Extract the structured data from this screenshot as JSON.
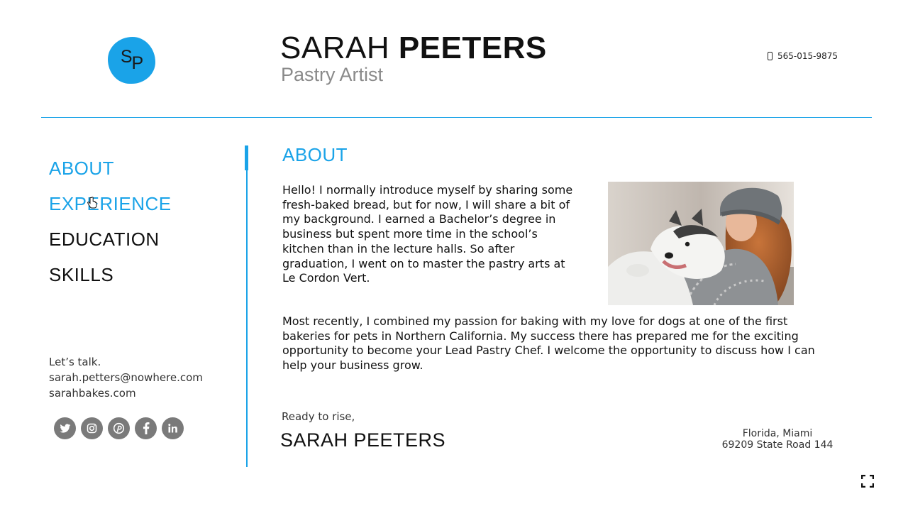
{
  "logo": {
    "initial_first": "S",
    "initial_last": "P",
    "color": "#1aa3e8"
  },
  "header": {
    "first_name": "SARAH",
    "last_name": "PEETERS",
    "role": "Pastry Artist",
    "phone": "565-015-9875"
  },
  "nav": {
    "items": [
      {
        "label": "ABOUT",
        "active": true
      },
      {
        "label": "EXPERIENCE",
        "active": true
      },
      {
        "label": "EDUCATION",
        "active": false
      },
      {
        "label": "SKILLS",
        "active": false
      }
    ]
  },
  "contact": {
    "prompt": "Let’s talk.",
    "email": "sarah.petters@nowhere.com",
    "website": "sarahbakes.com"
  },
  "social": {
    "icons": [
      "twitter-icon",
      "instagram-icon",
      "pinterest-icon",
      "facebook-icon",
      "linkedin-icon"
    ]
  },
  "about": {
    "title": "ABOUT",
    "paragraph1": "Hello! I normally introduce myself by sharing some fresh-baked bread, but for now, I will share a bit of my background. I earned a Bachelor’s degree in business but spent more time in the school’s kitchen than in the lecture halls. So after graduation, I went on to master the pastry arts at Le Cordon Vert.",
    "paragraph2": "Most recently, I combined my passion for baking with my love for dogs at one of the first bakeries for pets in Northern California. My success there has prepared me for the exciting opportunity to become your Lead Pastry Chef. I welcome the opportunity to discuss how I can help your business grow."
  },
  "closing": {
    "signoff": "Ready to rise,",
    "signature": "SARAH PEETERS"
  },
  "address": {
    "line1": "Florida, Miami",
    "line2": "69209 State Road 144"
  },
  "colors": {
    "accent": "#1aa3e8",
    "icon_gray": "#7a7a7a"
  }
}
